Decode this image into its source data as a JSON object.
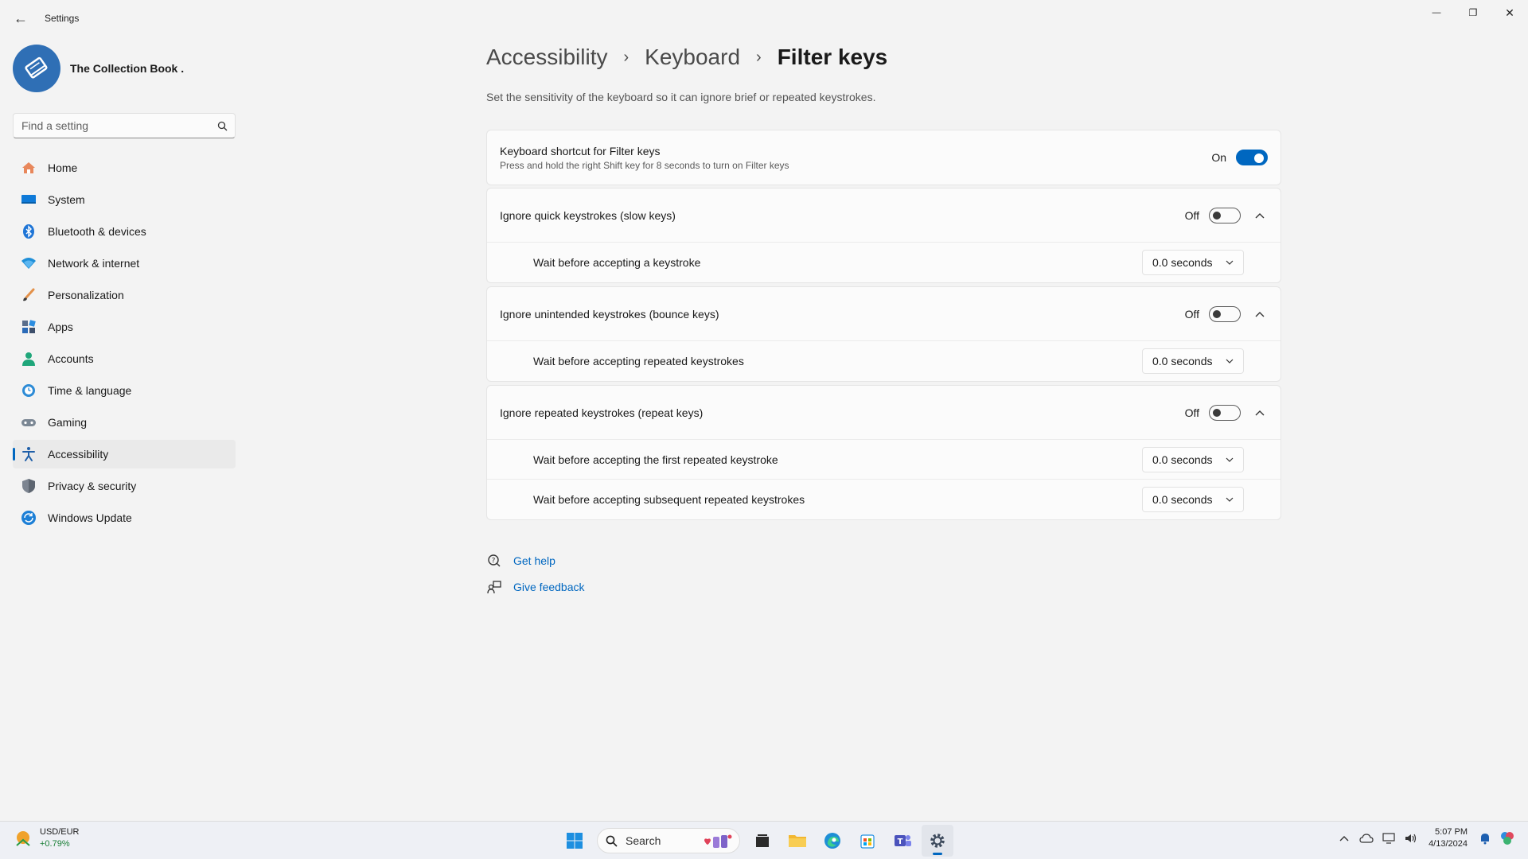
{
  "window": {
    "title": "Settings",
    "back_glyph": "←",
    "minimize_glyph": "—",
    "restore_glyph": "❐",
    "close_glyph": "✕"
  },
  "profile": {
    "name": "The Collection Book ."
  },
  "search": {
    "placeholder": "Find a setting"
  },
  "nav": {
    "items": [
      {
        "label": "Home",
        "icon": "home-icon",
        "active": false
      },
      {
        "label": "System",
        "icon": "system-icon",
        "active": false
      },
      {
        "label": "Bluetooth & devices",
        "icon": "bluetooth-icon",
        "active": false
      },
      {
        "label": "Network & internet",
        "icon": "network-icon",
        "active": false
      },
      {
        "label": "Personalization",
        "icon": "brush-icon",
        "active": false
      },
      {
        "label": "Apps",
        "icon": "apps-icon",
        "active": false
      },
      {
        "label": "Accounts",
        "icon": "accounts-icon",
        "active": false
      },
      {
        "label": "Time & language",
        "icon": "time-language-icon",
        "active": false
      },
      {
        "label": "Gaming",
        "icon": "gaming-icon",
        "active": false
      },
      {
        "label": "Accessibility",
        "icon": "accessibility-icon",
        "active": true
      },
      {
        "label": "Privacy & security",
        "icon": "shield-icon",
        "active": false
      },
      {
        "label": "Windows Update",
        "icon": "update-icon",
        "active": false
      }
    ]
  },
  "breadcrumb": {
    "level1": "Accessibility",
    "level2": "Keyboard",
    "current": "Filter keys",
    "separator": "›"
  },
  "page": {
    "description": "Set the sensitivity of the keyboard so it can ignore brief or repeated keystrokes."
  },
  "shortcut": {
    "title": "Keyboard shortcut for Filter keys",
    "description": "Press and hold the right Shift key for 8 seconds to turn on Filter keys",
    "state_label": "On"
  },
  "slow_keys": {
    "title": "Ignore quick keystrokes (slow keys)",
    "state_label": "Off",
    "sub_label": "Wait before accepting a keystroke",
    "value": "0.0 seconds"
  },
  "bounce_keys": {
    "title": "Ignore unintended keystrokes (bounce keys)",
    "state_label": "Off",
    "sub_label": "Wait before accepting repeated keystrokes",
    "value": "0.0 seconds"
  },
  "repeat_keys": {
    "title": "Ignore repeated keystrokes (repeat keys)",
    "state_label": "Off",
    "sub1_label": "Wait before accepting the first repeated keystroke",
    "sub1_value": "0.0 seconds",
    "sub2_label": "Wait before accepting subsequent repeated keystrokes",
    "sub2_value": "0.0 seconds"
  },
  "help": {
    "get_help": "Get help",
    "give_feedback": "Give feedback"
  },
  "taskbar": {
    "ticker_name": "USD/EUR",
    "ticker_change": "+0.79%",
    "search_label": "Search",
    "time": "5:07 PM",
    "date": "4/13/2024"
  },
  "colors": {
    "accent": "#0067c0",
    "background": "#f3f3f3",
    "card": "#fbfbfb"
  }
}
